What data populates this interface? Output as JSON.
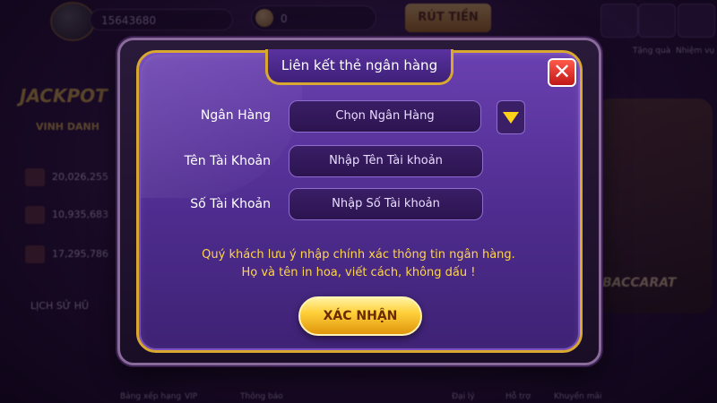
{
  "background": {
    "balance_id": "15643680",
    "coins": "0",
    "recharge_label": "RÚT TIỀN",
    "top_icons": [
      {
        "label": "Tặng quà"
      },
      {
        "label": "Nhiệm vụ"
      }
    ],
    "jackpot_label": "JACKPOT",
    "honor_label": "VINH DANH",
    "rank_values": [
      "20,026,255",
      "10,935,683",
      "17,295,786"
    ],
    "history_label": "LỊCH SỬ HŨ",
    "baccarat_label": "BACCARAT",
    "bottom_labels": [
      "Bảng xếp hạng",
      "VIP",
      "Thông báo",
      "Đại lý",
      "Hỗ trợ",
      "Khuyến mãi"
    ]
  },
  "dialog": {
    "title": "Liên kết thẻ ngân hàng",
    "close_icon": "close-icon",
    "fields": [
      {
        "label": "Ngân Hàng",
        "value": "Chọn Ngân Hàng"
      },
      {
        "label": "Tên Tài Khoản",
        "value": "Nhập Tên Tài khoản"
      },
      {
        "label": "Số Tài Khoản",
        "value": "Nhập Số Tài khoản"
      }
    ],
    "note_line1": "Quý khách lưu ý nhập chính xác thông tin ngân hàng.",
    "note_line2": "Họ và tên in hoa, viết cách, không dấu !",
    "confirm_label": "XÁC NHẬN"
  },
  "colors": {
    "panel": "#4e2c8e",
    "gold_border": "#d9a830",
    "note_text": "#ffd54a",
    "close": "#c01818"
  }
}
